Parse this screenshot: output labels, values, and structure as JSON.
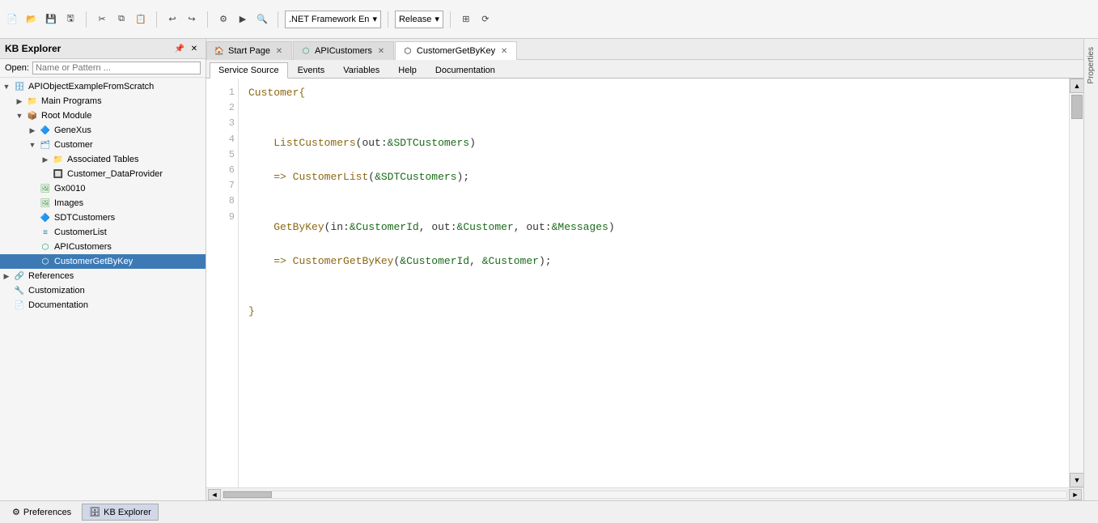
{
  "toolbar": {
    "framework_label": ".NET Framework En",
    "build_config": "Release",
    "buttons": [
      "file",
      "edit",
      "undo",
      "redo",
      "build",
      "run"
    ]
  },
  "sidebar": {
    "title": "KB Explorer",
    "open_label": "Open:",
    "open_placeholder": "Name or Pattern ...",
    "tree": [
      {
        "id": "root",
        "label": "APIObjectExampleFromScratch",
        "level": 0,
        "expanded": true,
        "icon": "kb",
        "arrow": "▼"
      },
      {
        "id": "main-programs",
        "label": "Main Programs",
        "level": 1,
        "expanded": false,
        "icon": "folder",
        "arrow": "▶"
      },
      {
        "id": "root-module",
        "label": "Root Module",
        "level": 1,
        "expanded": true,
        "icon": "module",
        "arrow": "▼"
      },
      {
        "id": "genexus",
        "label": "GeneXus",
        "level": 2,
        "expanded": false,
        "icon": "genexus",
        "arrow": "▶"
      },
      {
        "id": "customer",
        "label": "Customer",
        "level": 2,
        "expanded": true,
        "icon": "customer",
        "arrow": "▼"
      },
      {
        "id": "associated-tables",
        "label": "Associated Tables",
        "level": 3,
        "expanded": false,
        "icon": "folder",
        "arrow": "▶"
      },
      {
        "id": "customer-dp",
        "label": "Customer_DataProvider",
        "level": 3,
        "expanded": false,
        "icon": "dp",
        "arrow": ""
      },
      {
        "id": "gx0010",
        "label": "Gx0010",
        "level": 2,
        "expanded": false,
        "icon": "images",
        "arrow": ""
      },
      {
        "id": "images",
        "label": "Images",
        "level": 2,
        "expanded": false,
        "icon": "images",
        "arrow": ""
      },
      {
        "id": "sdtcustomers",
        "label": "SDTCustomers",
        "level": 2,
        "expanded": false,
        "icon": "sdt",
        "arrow": ""
      },
      {
        "id": "customerlist",
        "label": "CustomerList",
        "level": 2,
        "expanded": false,
        "icon": "list",
        "arrow": ""
      },
      {
        "id": "apicustomers",
        "label": "APICustomers",
        "level": 2,
        "expanded": false,
        "icon": "api",
        "arrow": ""
      },
      {
        "id": "customergetbykey",
        "label": "CustomerGetByKey",
        "level": 2,
        "expanded": false,
        "icon": "web",
        "arrow": "",
        "selected": true
      },
      {
        "id": "references",
        "label": "References",
        "level": 0,
        "expanded": false,
        "icon": "ref",
        "arrow": "▶"
      },
      {
        "id": "customization",
        "label": "Customization",
        "level": 0,
        "expanded": false,
        "icon": "custom",
        "arrow": ""
      },
      {
        "id": "documentation",
        "label": "Documentation",
        "level": 0,
        "expanded": false,
        "icon": "doc",
        "arrow": ""
      }
    ]
  },
  "tabs": [
    {
      "id": "start-page",
      "label": "Start Page",
      "icon": "home",
      "closable": true,
      "active": false
    },
    {
      "id": "apicustomers",
      "label": "APICustomers",
      "icon": "api",
      "closable": true,
      "active": false
    },
    {
      "id": "customergetbykey",
      "label": "CustomerGetByKey",
      "icon": "web",
      "closable": true,
      "active": true
    }
  ],
  "sub_tabs": [
    {
      "id": "service-source",
      "label": "Service Source",
      "active": true
    },
    {
      "id": "events",
      "label": "Events",
      "active": false
    },
    {
      "id": "variables",
      "label": "Variables",
      "active": false
    },
    {
      "id": "help",
      "label": "Help",
      "active": false
    },
    {
      "id": "documentation",
      "label": "Documentation",
      "active": false
    }
  ],
  "code": {
    "lines": [
      {
        "num": 1,
        "content": "Customer{"
      },
      {
        "num": 2,
        "content": ""
      },
      {
        "num": 3,
        "content": "    ListCustomers(out:&SDTCustomers)"
      },
      {
        "num": 4,
        "content": "    => CustomerList(&SDTCustomers);"
      },
      {
        "num": 5,
        "content": ""
      },
      {
        "num": 6,
        "content": "    GetByKey(in:&CustomerId, out:&Customer, out:&Messages)"
      },
      {
        "num": 7,
        "content": "    => CustomerGetByKey(&CustomerId, &Customer);"
      },
      {
        "num": 8,
        "content": ""
      },
      {
        "num": 9,
        "content": "}"
      }
    ]
  },
  "bottom_tabs": [
    {
      "id": "preferences",
      "label": "Preferences",
      "icon": "gear",
      "active": false
    },
    {
      "id": "kb-explorer",
      "label": "KB Explorer",
      "icon": "kb",
      "active": true
    }
  ],
  "properties_panel": {
    "label": "Properties"
  }
}
